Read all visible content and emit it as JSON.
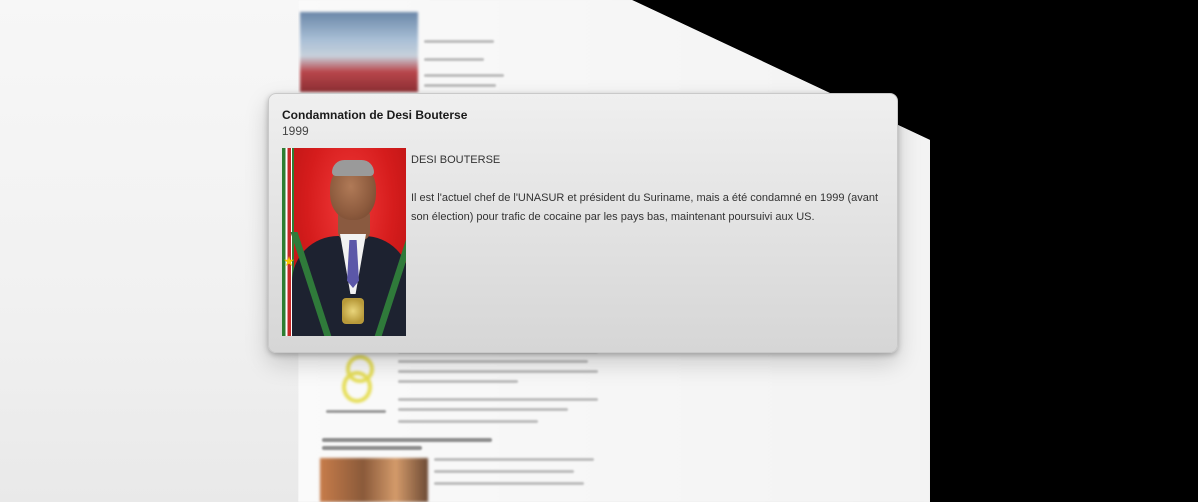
{
  "popover": {
    "title": "Condamnation de Desi Bouterse",
    "year": "1999",
    "name": "DESI BOUTERSE",
    "description": "Il est l'actuel chef de l'UNASUR et président du Suriname, mais a été condamné en 1999 (avant son élection) pour trafic de cocaine par les pays bas, maintenant poursuivi aux US.",
    "image_subject": "portrait-of-desi-bouterse"
  },
  "colors": {
    "portrait_background": "#d51c1c",
    "popover_background": "#e4e4e4",
    "backdrop_right": "#000000"
  }
}
